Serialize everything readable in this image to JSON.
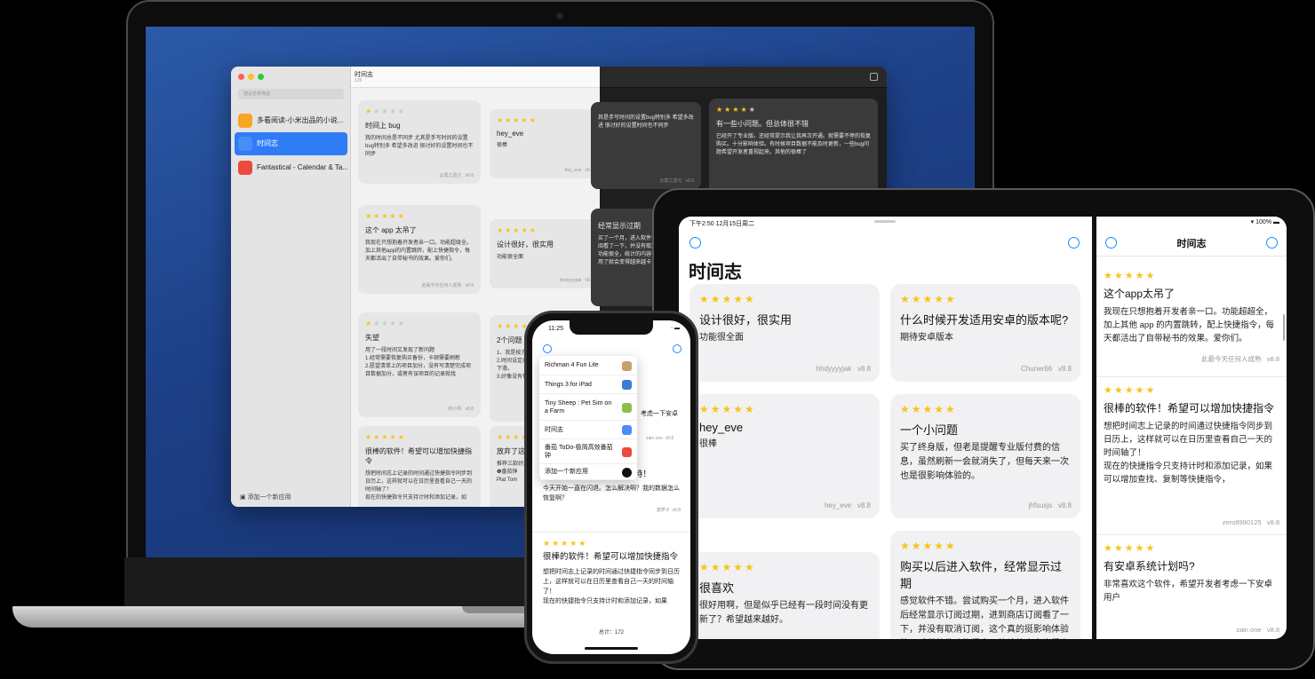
{
  "mac": {
    "search_placeholder": "建议名称筛选",
    "apps": [
      {
        "name": "多看阅读-小米出品的小说...",
        "color": "#f5a623"
      },
      {
        "name": "时间志",
        "color": "#4a8df8"
      },
      {
        "name": "Fantastical - Calendar & Ta...",
        "color": "#e94b3c"
      }
    ],
    "add_app": "添加一个新应用",
    "title": "时间志",
    "subtitle": "125",
    "cards": [
      {
        "rating": 1,
        "title": "时间上 bug",
        "body": "我的时间总是不同步 尤其是手写时间的设置bug特别多 希望多改进 很讨好的设置时间也不同步",
        "author": "云霞之遗元",
        "ver": "v8.8"
      },
      {
        "rating": 5,
        "title": "这个 app 太吊了",
        "body": "我现在只想抱着开发者亲一口。功能超级全。加上其他app的内置跳转，配上快捷指令，每天都活出了自带秘书的效果。爱你们。",
        "author": "此最今天任何人成熟",
        "ver": "v8.8"
      },
      {
        "rating": 1,
        "title": "失望",
        "body": "用了一段时间又发现了新问题\n1.经常需要恢复购买备份，卡顿需要刷新\n2.愿望清单上的项目加分，没有写清楚完成项目数据加分，或者有误项目的记录就找",
        "author": "林小林",
        "ver": "v8.8"
      },
      {
        "rating": 5,
        "title": "很棒的软件！希望可以增加快捷指令",
        "body": "想把时间志上记录的时间通过快捷指令同步到日历上，这样就可以在日历里查看自己一天的时间轴了！\n现在的快捷指令只支持计时和添加记录，如",
        "author": "",
        "ver": ""
      },
      {
        "rating": 5,
        "title": "hey_eve",
        "body": "很棒",
        "author": "hey_eve",
        "ver": "v8.8"
      },
      {
        "rating": 5,
        "title": "设计很好，很实用",
        "body": "功能很全面",
        "author": "hhdyyyyjak",
        "ver": "v8.8"
      },
      {
        "rating": 5,
        "title": "2个问题",
        "body": "1、我是按方式设定问题\n2.时间设定出现问题，卡顿，有时大幅度下滑。\n3.好像没有什么，时间不能完成",
        "author": "",
        "ver": ""
      },
      {
        "rating": 5,
        "title": "放弃了这",
        "body": "推荐三款好用\n❶番茄钟\nPlat Tom",
        "author": "",
        "ver": ""
      }
    ],
    "dark_cards": [
      {
        "rating": 4,
        "title": "有一些小问题。但总体很不错",
        "body": "已经开了专业版。还经常提示我让我再次开通。就需要不停的恢复购买。十分影响体验。有时候项目数据不能及时更新，一些bug问题希望开发者重视起来。其他的很棒了",
        "author": "hjyvvz",
        "ver": "v8.8"
      },
      {
        "rating": 0,
        "title": "",
        "body": "其是手写时间的设置bug特别多 希望多改进 很讨好的设置时间也不同步",
        "author": "云霞之遗元",
        "ver": "v8.8"
      },
      {
        "rating": 0,
        "title": "经常显示过期",
        "body": "买了一个月，进入软件订阅，进入商店订阅看了一下，并没有取消订阅，感觉软件功能很全，统计的内容也多，但是我手机用了就会变得越来越卡，就希望更新一下",
        "author": "",
        "ver": ""
      }
    ]
  },
  "ipad": {
    "status_time": "下午2:50",
    "status_date": "12月15日周二",
    "battery": "100%",
    "title": "时间志",
    "right_title": "时间志",
    "cards": [
      {
        "rating": 5,
        "title": "设计很好，很实用",
        "body": "功能很全面",
        "author": "hhdyyyyjak",
        "ver": "v8.8"
      },
      {
        "rating": 5,
        "title": "什么时候开发适用安卓的版本呢?",
        "body": "期待安卓版本",
        "author": "Chuner66",
        "ver": "v8.8"
      },
      {
        "rating": 5,
        "title": "hey_eve",
        "body": "很棒",
        "author": "hey_eve",
        "ver": "v8.8"
      },
      {
        "rating": 5,
        "title": "一个小问题",
        "body": "买了终身版，但老是提醒专业版付费的信息，虽然刷新一会就消失了，但每天来一次也是很影响体验的。",
        "author": "jhfsusjs",
        "ver": "v8.8"
      },
      {
        "rating": 5,
        "title": "很喜欢",
        "body": "很好用啊，但是似乎已经有一段时间没有更新了？希望越来越好。",
        "author": "",
        "ver": ""
      },
      {
        "rating": 5,
        "title": "购买以后进入软件，经常显示过期",
        "body": "感觉软件不错。尝试购买一个月，进入软件后经常显示订阅过期，进到商店订阅看了一下，并没有取消订阅，这个真的挺影响体验的，感觉软件功能很全，统计的内容也很实",
        "author": "",
        "ver": ""
      }
    ],
    "right_cards": [
      {
        "rating": 5,
        "title": "这个app太吊了",
        "body": "我现在只想抱着开发者亲一口。功能超超全，加上其他 app 的内置跳转，配上快捷指令，每天都活出了自带秘书的效果。爱你们。",
        "author": "此最今天任何人成熟",
        "ver": "v8.8"
      },
      {
        "rating": 5,
        "title": "很棒的软件！希望可以增加快捷指令",
        "body": "想把时间志上记录的时间通过快捷指令同步到日历上，这样就可以在日历里查看自己一天的时间轴了！\n现在的快捷指令只支持计时和添加记录，如果可以增加查找、复制等快捷指令，",
        "author": "zero9990125",
        "ver": "v8.8"
      },
      {
        "rating": 5,
        "title": "有安卓系统计划吗?",
        "body": "非常喜欢这个软件，希望开发者考虑一下安卓用户",
        "author": "zain one",
        "ver": "v8.8"
      }
    ]
  },
  "iphone": {
    "time": "11:25",
    "menu": [
      {
        "name": "Richman 4 Fun Lite",
        "color": "#c8a06a"
      },
      {
        "name": "Things 3 for iPad",
        "color": "#3a7bd5"
      },
      {
        "name": "Tiny Sheep : Pet Sim on a Farm",
        "color": "#8bbf4a"
      },
      {
        "name": "时间志",
        "color": "#4a8df8"
      },
      {
        "name": "番茄 ToDo-极简高效番茄钟",
        "color": "#e94b3c"
      },
      {
        "name": "添加一个新应用",
        "color": "#111111"
      }
    ],
    "peek1": "考虑一下安卓",
    "peek1_author": "zain one",
    "peek1_ver": "v8.8",
    "card1": {
      "title": "...恢复数据呀！！！求支持！",
      "body": "今天开始一直在闪退。怎么解决啊？我的数据怎么恢复啊？",
      "author": "菠萝子",
      "ver": "v8.8"
    },
    "card2": {
      "rating": 5,
      "title": "很棒的软件！希望可以增加快捷指令",
      "body": "想把时间志上记录的时间通过快捷指令同步到日历上，这样就可以在日历里查看自己一天的时间轴了！\n现在的快捷指令只支持计时和添加记录，如果"
    },
    "total": "总计：172"
  }
}
